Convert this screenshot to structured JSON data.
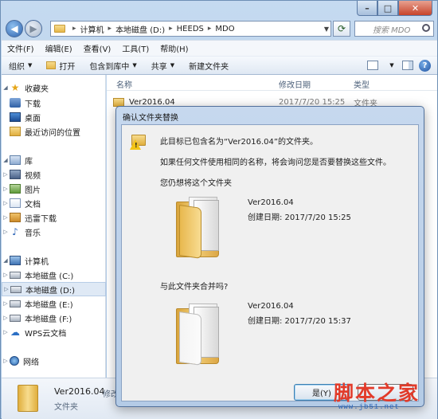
{
  "address": {
    "crumbs": [
      "计算机",
      "本地磁盘 (D:)",
      "HEEDS",
      "MDO"
    ],
    "search_placeholder": "搜索 MDO"
  },
  "menu": [
    "文件(F)",
    "编辑(E)",
    "查看(V)",
    "工具(T)",
    "帮助(H)"
  ],
  "toolbar": {
    "organize": "组织",
    "open": "打开",
    "include": "包含到库中",
    "share": "共享",
    "new_folder": "新建文件夹"
  },
  "nav": {
    "favorites": "收藏夹",
    "downloads": "下载",
    "desktop": "桌面",
    "recent": "最近访问的位置",
    "libraries": "库",
    "videos": "视频",
    "pictures": "图片",
    "documents": "文档",
    "xunlei": "迅雷下载",
    "music": "音乐",
    "computer": "计算机",
    "drive_c": "本地磁盘 (C:)",
    "drive_d": "本地磁盘 (D:)",
    "drive_e": "本地磁盘 (E:)",
    "drive_f": "本地磁盘 (F:)",
    "wps": "WPS云文档",
    "network": "网络"
  },
  "columns": {
    "name": "名称",
    "date": "修改日期",
    "type": "类型"
  },
  "files": [
    {
      "name": "Ver2016.04",
      "date": "2017/7/20 15:25",
      "type": "文件夹"
    }
  ],
  "details": {
    "name": "Ver2016.04",
    "modified_prefix": "修改",
    "type": "文件夹"
  },
  "dialog": {
    "title": "确认文件夹替换",
    "message1": "此目标已包含名为“Ver2016.04”的文件夹。",
    "message2": "如果任何文件使用相同的名称，将会询问您是否要替换这些文件。",
    "message3": "您仍想将这个文件夹",
    "message4": "与此文件夹合并吗?",
    "target_name": "Ver2016.04",
    "target_created": "创建日期: 2017/7/20 15:25",
    "source_name": "Ver2016.04",
    "source_created": "创建日期: 2017/7/20 15:37",
    "yes_label": "是(Y)",
    "no_label": ""
  },
  "watermark": {
    "logo": "脚本之家",
    "url": "www.jb51.net"
  },
  "colors": {
    "accent": "#3c7fb1",
    "folder": "#e0ae3e",
    "watermark_red": "#e23b2a",
    "watermark_blue": "#2a64b8"
  }
}
